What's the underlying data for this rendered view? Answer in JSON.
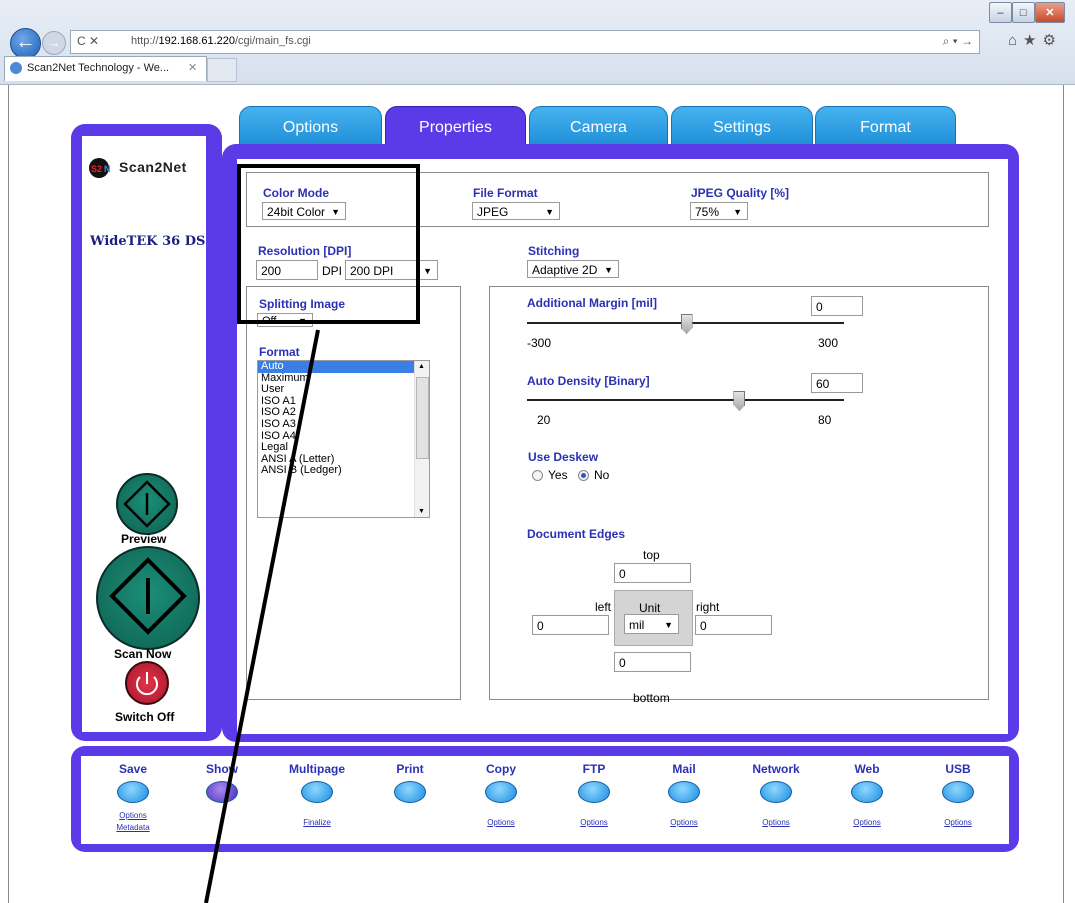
{
  "browser": {
    "url_prefix": "http://",
    "url_host": "192.168.61.220",
    "url_path": "/cgi/main_fs.cgi",
    "tab_title": "Scan2Net Technology - We...",
    "addr_left_icons": "C ✕",
    "addr_right_icons": "⌕ ▾ →",
    "tool_icons": "⌂★⚙",
    "back": "←",
    "forward": "→",
    "tab_close": "✕",
    "win_min": "–",
    "win_max": "□",
    "win_close": "✕"
  },
  "left_panel": {
    "logo_text": "Scan2Net",
    "model": "WideTEK 36 DS",
    "preview_label": "Preview",
    "scan_label": "Scan Now",
    "off_label": "Switch Off"
  },
  "tabs": [
    "Options",
    "Properties",
    "Camera",
    "Settings",
    "Format"
  ],
  "active_tab": "Properties",
  "properties": {
    "color_mode": {
      "label": "Color Mode",
      "value": "24bit Color"
    },
    "file_format": {
      "label": "File Format",
      "value": "JPEG"
    },
    "jpeg_quality": {
      "label": "JPEG Quality [%]",
      "value": "75%"
    },
    "resolution": {
      "label": "Resolution [DPI]",
      "value": "200",
      "unit": "DPI",
      "preset": "200 DPI"
    },
    "stitching": {
      "label": "Stitching",
      "value": "Adaptive 2D"
    },
    "splitting": {
      "label": "Splitting Image",
      "value": "Off"
    },
    "format": {
      "label": "Format",
      "items": [
        "Auto",
        "Maximum",
        "User",
        "ISO A1",
        "ISO A2",
        "ISO A3",
        "ISO A4",
        "Legal",
        "ANSI A (Letter)",
        "ANSI B (Ledger)"
      ],
      "selected": "Auto"
    },
    "additional_margin": {
      "label": "Additional Margin [mil]",
      "value": "0",
      "min": "-300",
      "max": "300",
      "level": 0.5
    },
    "auto_density": {
      "label": "Auto Density [Binary]",
      "value": "60",
      "min": "20",
      "max": "80",
      "level": 0.667
    },
    "deskew": {
      "label": "Use Deskew",
      "yes": "Yes",
      "no": "No",
      "selected": "No"
    },
    "edges": {
      "label": "Document Edges",
      "top_label": "top",
      "top": "0",
      "left_label": "left",
      "left": "0",
      "right_label": "right",
      "right": "0",
      "bottom_label": "bottom",
      "bottom": "0",
      "unit_label": "Unit",
      "unit": "mil"
    }
  },
  "bottom_bar": [
    {
      "label": "Save",
      "links": [
        "Options",
        "Metadata"
      ]
    },
    {
      "label": "Show",
      "links": []
    },
    {
      "label": "Multipage",
      "links": [
        "Finalize"
      ]
    },
    {
      "label": "Print",
      "links": []
    },
    {
      "label": "Copy",
      "links": [
        "Options"
      ]
    },
    {
      "label": "FTP",
      "links": [
        "Options"
      ]
    },
    {
      "label": "Mail",
      "links": [
        "Options"
      ]
    },
    {
      "label": "Network",
      "links": [
        "Options"
      ]
    },
    {
      "label": "Web",
      "links": [
        "Options"
      ]
    },
    {
      "label": "USB",
      "links": [
        "Options"
      ]
    }
  ]
}
